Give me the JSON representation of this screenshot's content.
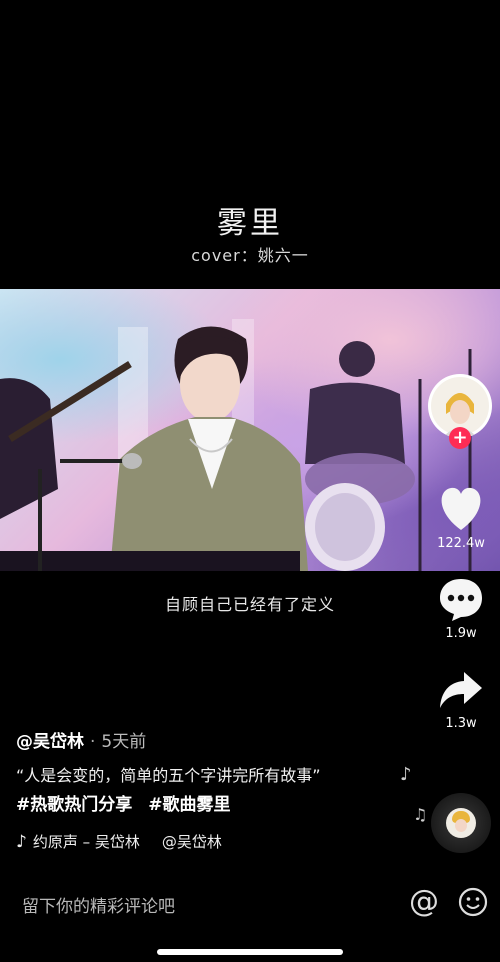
{
  "header": {
    "song_title": "雾里",
    "song_cover": "cover：姚六一"
  },
  "video": {
    "subtitle": "自顾自己已经有了定义"
  },
  "sidebar": {
    "likes": "122.4w",
    "comments": "1.9w",
    "shares": "1.3w",
    "icons": [
      "avatar",
      "follow-plus-icon",
      "heart-icon",
      "comment-icon",
      "share-icon",
      "music-disc-icon"
    ]
  },
  "post": {
    "author": "@吴岱林",
    "separator": "·",
    "time": "5天前",
    "caption": "“人是会变的，简单的五个字讲完所有故事”",
    "hashtags": [
      "#热歌热门分享",
      "#歌曲雾里"
    ],
    "music": "约原声 – 吴岱林",
    "music_author": "@吴岱林"
  },
  "comment_bar": {
    "placeholder": "留下你的精彩评论吧",
    "at_symbol": "@"
  },
  "colors": {
    "background": "#000000",
    "follow_badge": "#fe2c55",
    "text_secondary": "#b8b8b8"
  }
}
